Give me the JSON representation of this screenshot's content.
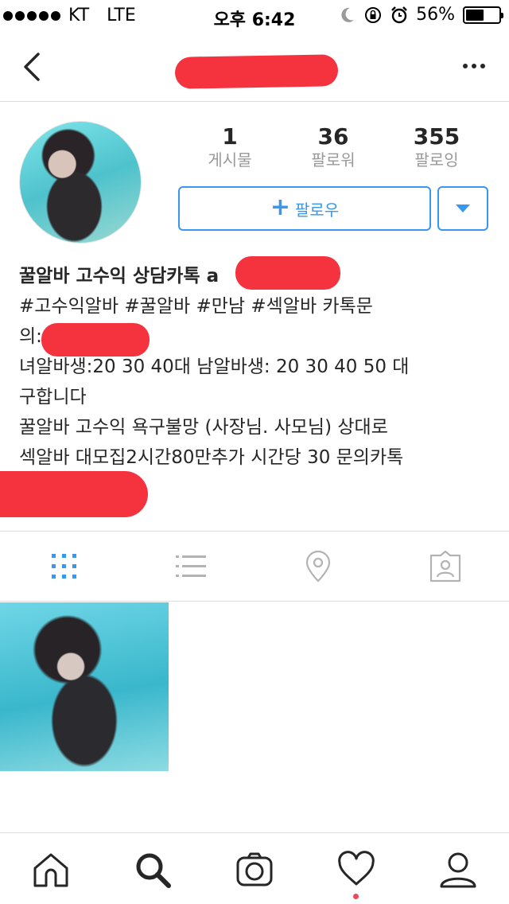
{
  "status_bar": {
    "carrier": "KT",
    "network": "LTE",
    "time": "오후 6:42",
    "battery": "56%",
    "battery_level": 0.56
  },
  "profile": {
    "stats": [
      {
        "value": "1",
        "label": "게시물"
      },
      {
        "value": "36",
        "label": "팔로워"
      },
      {
        "value": "355",
        "label": "팔로잉"
      }
    ],
    "follow_label": "팔로우",
    "bio": {
      "name": "꿀알바 고수익 상담카톡 a",
      "lines": [
        "#고수익알바 #꿀알바 #만남 #섹알바 카톡문",
        "의:",
        "녀알바생:20 30 40대 남알바생: 20 30 40 50 대",
        "구합니다",
        "꿀알바 고수익 욕구불망 (사장님. 사모님) 상대로",
        "섹알바 대모집2시간80만추가 시간당 30 문의카톡"
      ]
    }
  },
  "icons": {
    "back": "chevron-left-icon",
    "more": "more-horizontal-icon",
    "grid": "grid-icon",
    "list": "list-icon",
    "location": "location-pin-icon",
    "tagged": "tagged-person-icon",
    "home": "home-icon",
    "search": "search-icon",
    "camera": "camera-icon",
    "activity": "heart-icon",
    "profile": "person-icon"
  },
  "colors": {
    "accent": "#3897f0",
    "redaction": "#f5333f",
    "notification": "#ed4956"
  }
}
